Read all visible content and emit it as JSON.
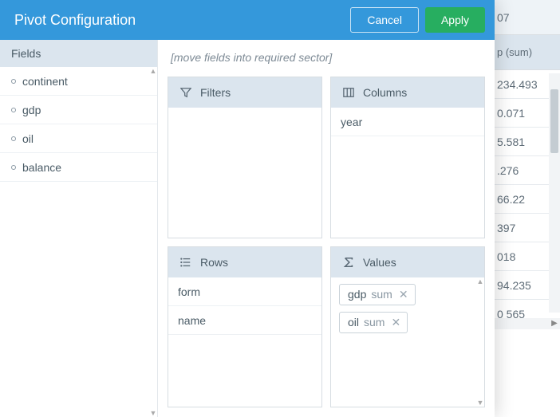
{
  "dialog": {
    "title": "Pivot Configuration",
    "cancel": "Cancel",
    "apply": "Apply",
    "hint": "[move fields into required sector]"
  },
  "fields": {
    "header": "Fields",
    "items": [
      "continent",
      "gdp",
      "oil",
      "balance"
    ]
  },
  "zones": {
    "filters": {
      "label": "Filters",
      "items": []
    },
    "columns": {
      "label": "Columns",
      "items": [
        "year"
      ]
    },
    "rows": {
      "label": "Rows",
      "items": [
        "form",
        "name"
      ]
    },
    "values": {
      "label": "Values",
      "chips": [
        {
          "field": "gdp",
          "op": "sum"
        },
        {
          "field": "oil",
          "op": "sum"
        }
      ]
    }
  },
  "bg": {
    "header_top": "07",
    "header_sub": "p (sum)",
    "cells": [
      "234.493",
      "0.071",
      "5.581",
      ".276",
      "66.22",
      "397",
      "018",
      "94.235",
      "0 565"
    ]
  }
}
